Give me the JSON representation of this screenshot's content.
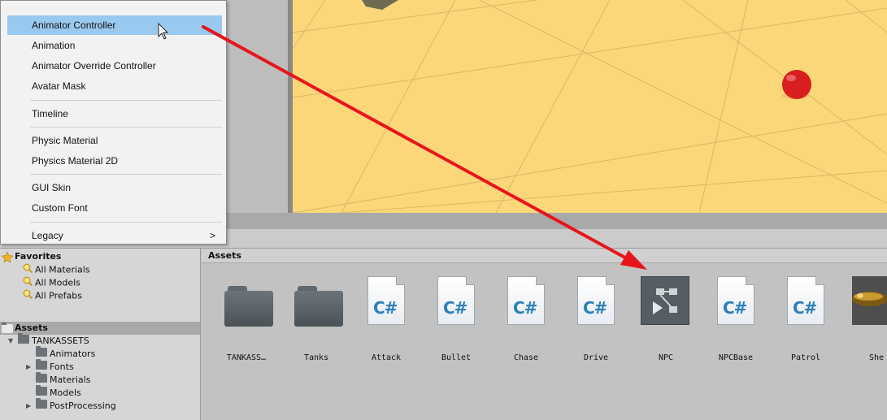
{
  "menu": {
    "items": [
      {
        "label": "Animator Controller"
      },
      {
        "label": "Animation"
      },
      {
        "label": "Animator Override Controller"
      },
      {
        "label": "Avatar Mask"
      },
      {
        "label": "Timeline"
      },
      {
        "label": "Physic Material"
      },
      {
        "label": "Physics Material 2D"
      },
      {
        "label": "GUI Skin"
      },
      {
        "label": "Custom Font"
      },
      {
        "label": "Legacy"
      }
    ],
    "legacy_arrow": ">"
  },
  "tree": {
    "favorites": {
      "title": "Favorites",
      "items": [
        "All Materials",
        "All Models",
        "All Prefabs"
      ]
    },
    "assets": {
      "title": "Assets",
      "root": "TANKASSETS",
      "children": [
        "Animators",
        "Fonts",
        "Materials",
        "Models",
        "PostProcessing"
      ]
    }
  },
  "grid": {
    "header": "Assets",
    "items": [
      {
        "label": "TANKASS…",
        "type": "folder"
      },
      {
        "label": "Tanks",
        "type": "folder"
      },
      {
        "label": "Attack",
        "type": "script"
      },
      {
        "label": "Bullet",
        "type": "script"
      },
      {
        "label": "Chase",
        "type": "script"
      },
      {
        "label": "Drive",
        "type": "script"
      },
      {
        "label": "NPC",
        "type": "animator"
      },
      {
        "label": "NPCBase",
        "type": "script"
      },
      {
        "label": "Patrol",
        "type": "script"
      },
      {
        "label": "She",
        "type": "model"
      }
    ],
    "script_glyph": "C#"
  },
  "colors": {
    "menu_highlight": "#99c9ef",
    "arrow": "#e8141c",
    "ground": "#fbd77a",
    "sphere": "#d81e1e"
  }
}
